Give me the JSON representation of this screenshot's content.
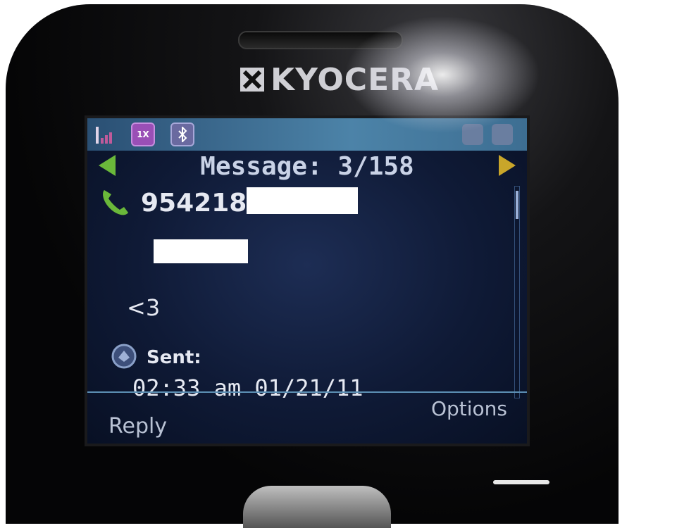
{
  "brand": {
    "name": "KYOCERA"
  },
  "status_bar": {
    "icons": [
      "signal-strength-icon",
      "1x-network-icon",
      "bluetooth-icon",
      "battery-icon"
    ],
    "onex_label": "1X",
    "bt_label": "ʙ"
  },
  "message_view": {
    "title": "Message: 3/158",
    "phone_number_visible": "954218",
    "body_line": "<3",
    "sent_label": "Sent:",
    "sent_timestamp": "02:33 am 01/21/11"
  },
  "softkeys": {
    "left": "Reply",
    "right": "Options"
  },
  "colors": {
    "screen_bg": "#0f1a36",
    "status_bar": "#4c83a8",
    "left_arrow": "#6ab83a",
    "right_arrow": "#c9a62a",
    "phone_icon": "#6ab83a"
  }
}
